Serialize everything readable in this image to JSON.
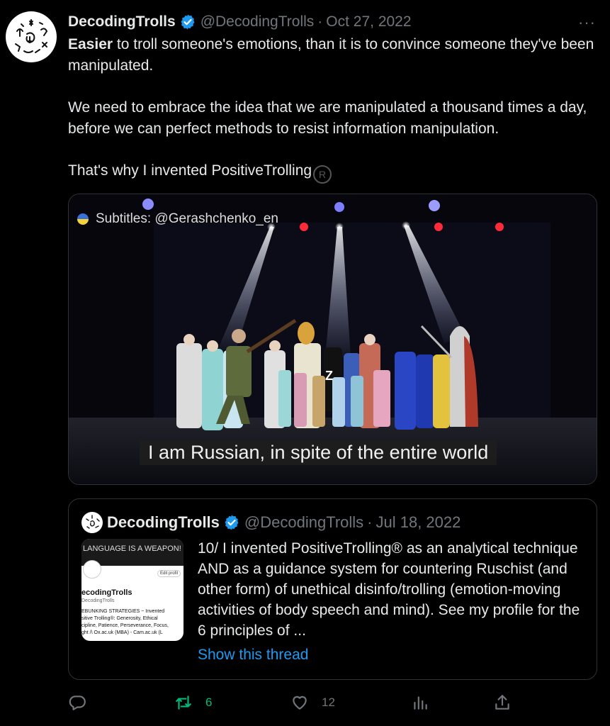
{
  "tweet": {
    "author_name": "DecodingTrolls",
    "handle": "@DecodingTrolls",
    "separator": "·",
    "date": "Oct 27, 2022",
    "more": "···",
    "text_bold": "Easier",
    "text_line1": " to troll someone's emotions, than it is to convince someone they've been manipulated.",
    "text_para2": "We need to embrace the idea that we are manipulated a thousand times a day, before we can perfect methods to resist information manipulation.",
    "text_para3": "That's why I invented PositiveTrolling",
    "registered_mark": "R"
  },
  "media": {
    "subtitle_credit": "Subtitles: @Gerashchenko_en",
    "caption": "I am Russian, in spite of the entire world",
    "shirt_letter": "Z"
  },
  "quoted_tweet": {
    "author_name": "DecodingTrolls",
    "handle": "@DecodingTrolls",
    "separator": "·",
    "date": "Jul 18, 2022",
    "text": "10/ I invented PositiveTrolling® as an analytical technique AND as a guidance system for countering Ruschist (and other form) of unethical disinfo/trolling (emotion-moving activities of body speech and mind). See my profile for the 6 principles of ...",
    "show_thread": "Show this thread",
    "thumbnail": {
      "banner": "LANGUAGE IS A WEAPON!",
      "edit": "Edit profil",
      "name": "ecodingTrolls",
      "handle": "DecodingTrolls",
      "bio_1": "EBUNKING STRATEGIES ~ Invented",
      "bio_2": "sitive Trolling®: Generosity, Ethical",
      "bio_3": "cipline, Patience, Perseverance, Focus,",
      "bio_4": "ght /\\ Ox.ac.uk (MBA) - Cam.ac.uk (L"
    }
  },
  "actions": {
    "retweets": "6",
    "likes": "12"
  },
  "colors": {
    "background": "#000000",
    "text": "#e7e9ea",
    "muted": "#71767b",
    "link": "#1d9bf0",
    "retweet": "#00ba7c",
    "verified": "#1d9bf0"
  }
}
